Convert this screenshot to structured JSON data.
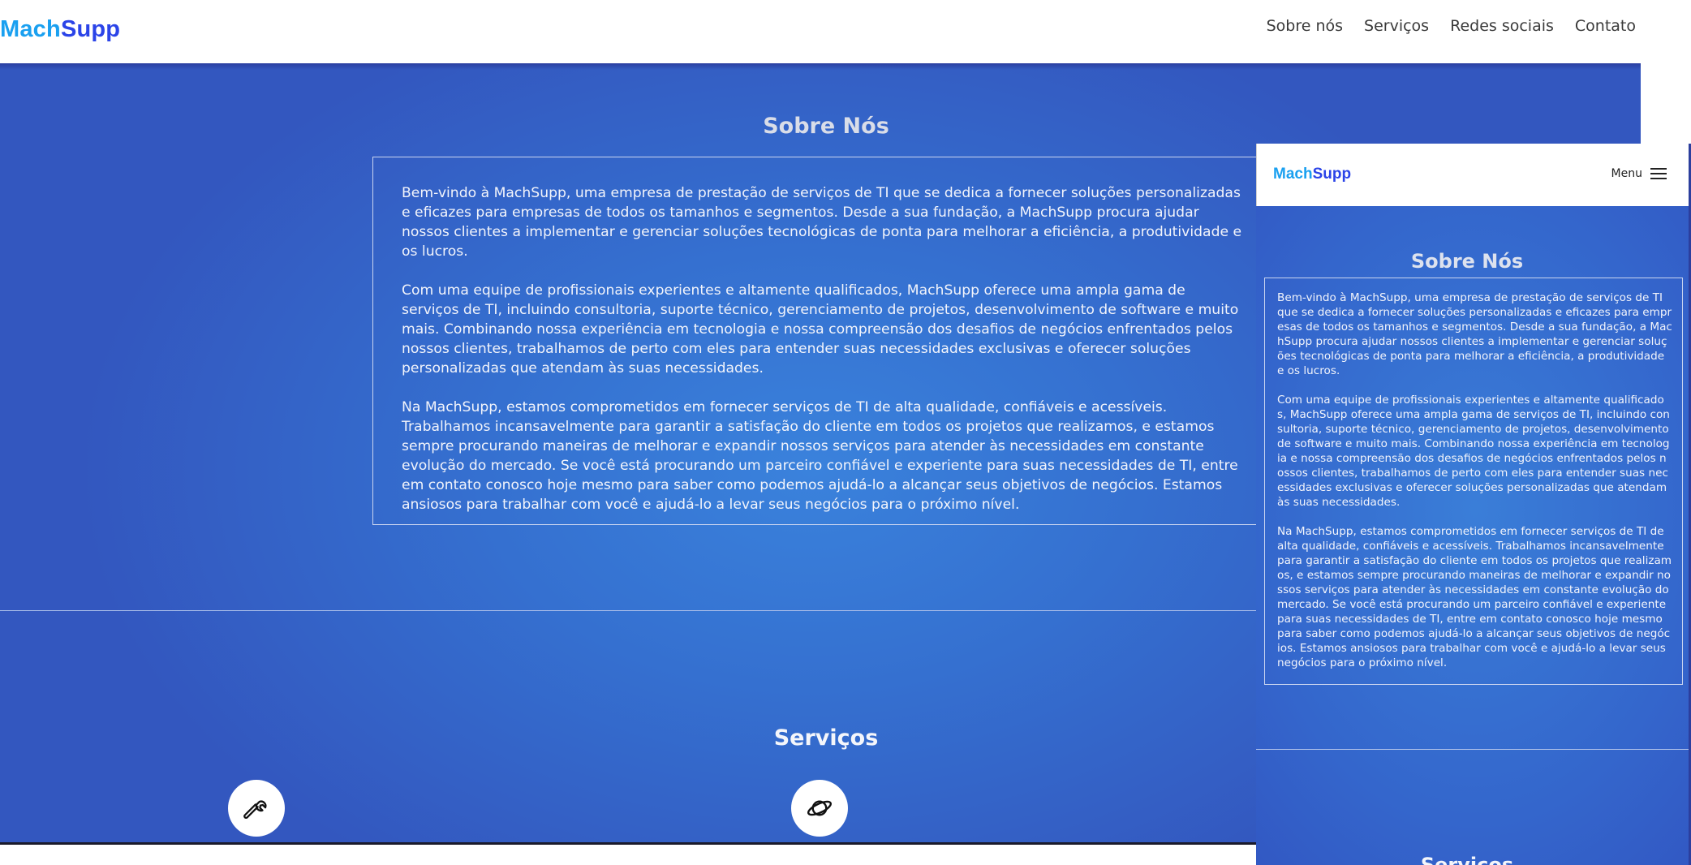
{
  "colors": {
    "brand_blue": "#2b44e8",
    "brand_light_blue": "#1aa0f0",
    "background_gradient_start": "#3357bf",
    "background_gradient_center": "#3a82dc",
    "text_light": "#f2f4fb"
  },
  "brand": {
    "logo_part1": "Mach",
    "logo_part2": "Supp"
  },
  "nav": {
    "items": [
      {
        "label": "Sobre nós"
      },
      {
        "label": "Serviços"
      },
      {
        "label": "Redes sociais"
      },
      {
        "label": "Contato"
      }
    ]
  },
  "about": {
    "title": "Sobre Nós",
    "paragraphs": [
      "Bem-vindo à MachSupp, uma empresa de prestação de serviços de TI que se dedica a fornecer soluções personalizadas e eficazes para empresas de todos os tamanhos e segmentos. Desde a sua fundação, a MachSupp procura ajudar nossos clientes a implementar e gerenciar soluções tecnológicas de ponta para melhorar a eficiência, a produtividade e os lucros.",
      "Com uma equipe de profissionais experientes e altamente qualificados, MachSupp oferece uma ampla gama de serviços de TI, incluindo consultoria, suporte técnico, gerenciamento de projetos, desenvolvimento de software e muito mais. Combinando nossa experiência em tecnologia e nossa compreensão dos desafios de negócios enfrentados pelos nossos clientes, trabalhamos de perto com eles para entender suas necessidades exclusivas e oferecer soluções personalizadas que atendam às suas necessidades.",
      "Na MachSupp, estamos comprometidos em fornecer serviços de TI de alta qualidade, confiáveis e acessíveis. Trabalhamos incansavelmente para garantir a satisfação do cliente em todos os projetos que realizamos, e estamos sempre procurando maneiras de melhorar e expandir nossos serviços para atender às necessidades em constante evolução do mercado. Se você está procurando um parceiro confiável e experiente para suas necessidades de TI, entre em contato conosco hoje mesmo para saber como podemos ajudá-lo a alcançar seus objetivos de negócios. Estamos ansiosos para trabalhar com você e ajudá-lo a levar seus negócios para o próximo nível."
    ]
  },
  "services": {
    "title": "Serviços",
    "icons": [
      "wrench-icon",
      "planet-icon"
    ]
  },
  "mobile": {
    "menu_label": "Menu"
  }
}
